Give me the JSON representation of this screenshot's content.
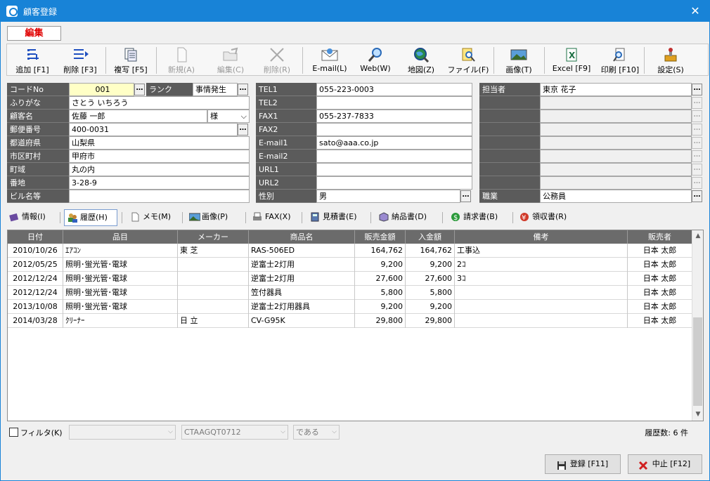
{
  "window": {
    "title": "顧客登録",
    "close": "✕"
  },
  "mode_label": "編集",
  "toolbar": [
    {
      "label": "追加 [F1]",
      "icon": "add-icon",
      "disabled": false
    },
    {
      "label": "削除 [F3]",
      "icon": "delete-icon",
      "disabled": false
    },
    {
      "label": "複写 [F5]",
      "icon": "copy-icon",
      "disabled": false
    },
    {
      "label": "新規(A)",
      "icon": "new-document-icon",
      "disabled": true
    },
    {
      "label": "編集(C)",
      "icon": "edit-folder-icon",
      "disabled": true
    },
    {
      "label": "削除(R)",
      "icon": "remove-x-icon",
      "disabled": true
    },
    {
      "label": "E-mail(L)",
      "icon": "envelope-icon",
      "disabled": false
    },
    {
      "label": "Web(W)",
      "icon": "magnifier-icon",
      "disabled": false
    },
    {
      "label": "地図(Z)",
      "icon": "globe-icon",
      "disabled": false
    },
    {
      "label": "ファイル(F)",
      "icon": "file-search-icon",
      "disabled": false
    },
    {
      "label": "画像(T)",
      "icon": "picture-icon",
      "disabled": false
    },
    {
      "label": "Excel [F9]",
      "icon": "excel-icon",
      "disabled": false
    },
    {
      "label": "印刷 [F10]",
      "icon": "print-icon",
      "disabled": false
    },
    {
      "label": "設定(S)",
      "icon": "settings-icon",
      "disabled": false
    }
  ],
  "customer": {
    "code_label": "コードNo",
    "code": "001",
    "rank_label": "ランク",
    "rank": "事情発生",
    "furigana_label": "ふりがな",
    "furigana": "さとう いちろう",
    "name_label": "顧客名",
    "name": "佐藤 一郎",
    "honorific": "様",
    "zip_label": "郵便番号",
    "zip": "400-0031",
    "pref_label": "都道府県",
    "pref": "山梨県",
    "city_label": "市区町村",
    "city": "甲府市",
    "town_label": "町域",
    "town": "丸の内",
    "number_label": "番地",
    "number": "3-28-9",
    "building_label": "ビル名等",
    "building": ""
  },
  "contact": {
    "tel1_label": "TEL1",
    "tel1": "055-223-0003",
    "tel2_label": "TEL2",
    "tel2": "",
    "fax1_label": "FAX1",
    "fax1": "055-237-7833",
    "fax2_label": "FAX2",
    "fax2": "",
    "email1_label": "E-mail1",
    "email1": "sato@aaa.co.jp",
    "email2_label": "E-mail2",
    "email2": "",
    "url1_label": "URL1",
    "url1": "",
    "url2_label": "URL2",
    "url2": "",
    "gender_label": "性別",
    "gender": "男"
  },
  "staff": {
    "manager_label": "担当者",
    "manager": "東京 花子",
    "job_label": "職業",
    "job": "公務員"
  },
  "tabs": [
    {
      "label": "情報(I)",
      "icon": "book-icon",
      "active": false
    },
    {
      "label": "履歴(H)",
      "icon": "users-icon",
      "active": true
    },
    {
      "label": "メモ(M)",
      "icon": "memo-icon",
      "active": false
    },
    {
      "label": "画像(P)",
      "icon": "image-icon",
      "active": false
    },
    {
      "label": "FAX(X)",
      "icon": "fax-icon",
      "active": false
    },
    {
      "label": "見積書(E)",
      "icon": "calculator-icon",
      "active": false
    },
    {
      "label": "納品書(D)",
      "icon": "box-icon",
      "active": false
    },
    {
      "label": "請求書(B)",
      "icon": "dollar-icon",
      "active": false
    },
    {
      "label": "領収書(R)",
      "icon": "yen-icon",
      "active": false
    }
  ],
  "history": {
    "columns": [
      "日付",
      "品目",
      "メーカー",
      "商品名",
      "販売金額",
      "入金額",
      "備考",
      "販売者"
    ],
    "rows": [
      [
        "2010/10/26",
        "ｴｱｺﾝ",
        "東 芝",
        "RAS-506ED",
        "164,762",
        "164,762",
        "工事込",
        "日本 太郎"
      ],
      [
        "2012/05/25",
        "照明･蛍光管･電球",
        "",
        "逆富士2灯用",
        "9,200",
        "9,200",
        "2ｺ",
        "日本 太郎"
      ],
      [
        "2012/12/24",
        "照明･蛍光管･電球",
        "",
        "逆富士2灯用",
        "27,600",
        "27,600",
        "3ｺ",
        "日本 太郎"
      ],
      [
        "2012/12/24",
        "照明･蛍光管･電球",
        "",
        "笠付器具",
        "5,800",
        "5,800",
        "",
        "日本 太郎"
      ],
      [
        "2013/10/08",
        "照明･蛍光管･電球",
        "",
        "逆富士2灯用器具",
        "9,200",
        "9,200",
        "",
        "日本 太郎"
      ],
      [
        "2014/03/28",
        "ｸﾘｰﾅｰ",
        "日 立",
        "CV-G95K",
        "29,800",
        "29,800",
        "",
        "日本 太郎"
      ]
    ]
  },
  "filter": {
    "label": "フィルタ(K)",
    "field": "",
    "value": "CTAAGQT0712",
    "operator": "である",
    "count_text": "履歴数: 6 件"
  },
  "buttons": {
    "save": "登録 [F11]",
    "cancel": "中止 [F12]"
  },
  "colors": {
    "titlebar": "#1883d7",
    "label_bg": "#5b5b5b",
    "mode_text": "#e00000"
  }
}
